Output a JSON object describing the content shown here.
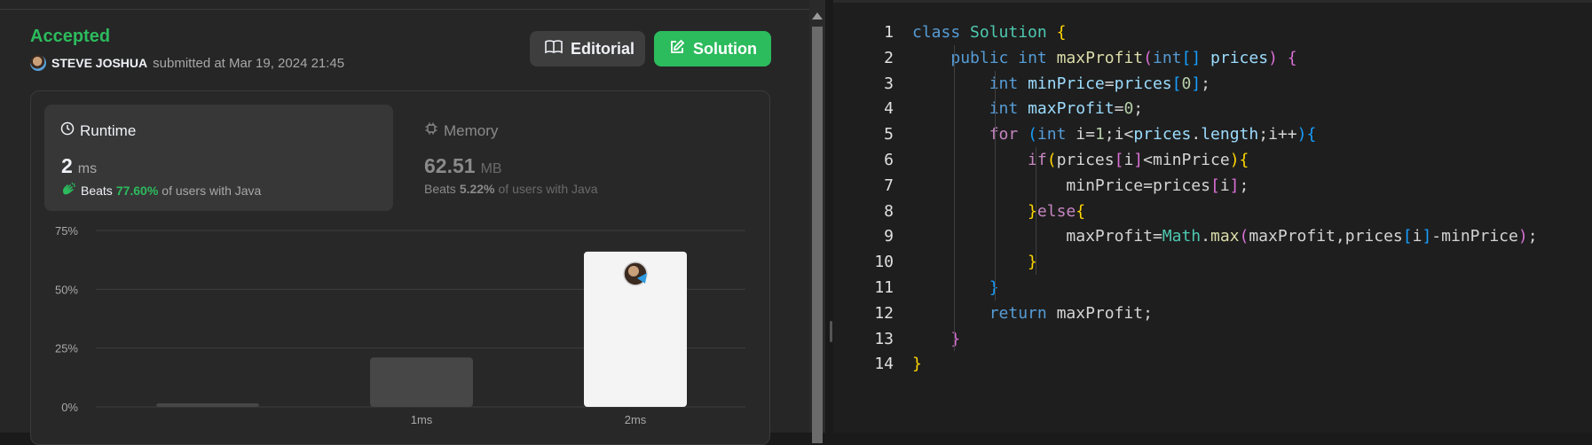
{
  "submission": {
    "status": "Accepted",
    "user": "STEVE JOSHUA",
    "submitted_text": "submitted at Mar 19, 2024 21:45"
  },
  "buttons": {
    "editorial": "Editorial",
    "solution": "Solution"
  },
  "runtime": {
    "title": "Runtime",
    "value": "2",
    "unit": "ms",
    "beats_label": "Beats",
    "beats_pct": "77.60%",
    "beats_suffix": "of users with Java"
  },
  "memory": {
    "title": "Memory",
    "value": "62.51",
    "unit": "MB",
    "beats_label": "Beats",
    "beats_pct": "5.22%",
    "beats_suffix": "of users with Java"
  },
  "colors": {
    "accent_green": "#2cbb5d",
    "bar_highlight": "#f4f4f4",
    "bar_default": "#474747"
  },
  "chart_data": {
    "type": "bar",
    "categories": [
      "",
      "1ms",
      "2ms"
    ],
    "values": [
      1.5,
      21,
      66
    ],
    "highlight_index": 2,
    "ylim": [
      0,
      75
    ],
    "yticks": [
      "0%",
      "25%",
      "50%",
      "75%"
    ],
    "ytick_values": [
      0,
      25,
      50,
      75
    ],
    "grid": true
  },
  "code": {
    "line_numbers": [
      "1",
      "2",
      "3",
      "4",
      "5",
      "6",
      "7",
      "8",
      "9",
      "10",
      "11",
      "12",
      "13",
      "14"
    ],
    "lines": [
      "class Solution {",
      "    public int maxProfit(int[] prices) {",
      "        int minPrice=prices[0];",
      "        int maxProfit=0;",
      "        for (int i=1;i<prices.length;i++){",
      "            if(prices[i]<minPrice){",
      "                minPrice=prices[i];",
      "            }else{",
      "                maxProfit=Math.max(maxProfit,prices[i]-minPrice);",
      "            }",
      "        }",
      "        return maxProfit;",
      "    }",
      "}"
    ]
  }
}
